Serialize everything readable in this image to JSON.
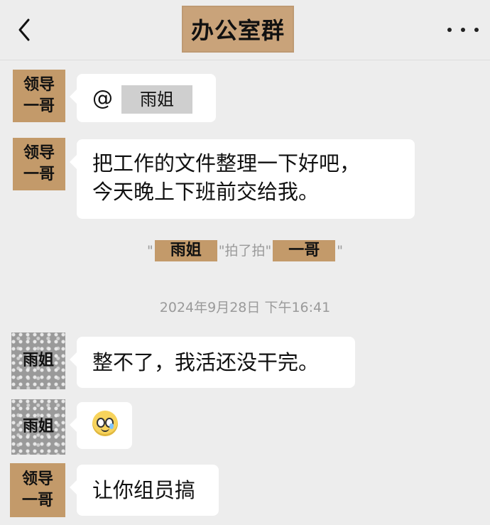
{
  "header": {
    "title": "办公室群",
    "back_icon": "chevron-left-icon",
    "more_icon": "more-dots-icon"
  },
  "avatars": {
    "leader": [
      "领导",
      "一哥"
    ],
    "sister": [
      "雨姐"
    ]
  },
  "messages": [
    {
      "sender": "领导一哥",
      "text_prefix": "@",
      "mention": "雨姐"
    },
    {
      "sender": "领导一哥",
      "lines": [
        "把工作的文件整理一下好吧，",
        "今天晚上下班前交给我。"
      ]
    },
    {
      "sender": "雨姐",
      "text": "整不了，我活还没干完。"
    },
    {
      "sender": "雨姐",
      "emoji": "woozy-face-emoji"
    },
    {
      "sender": "领导一哥",
      "text": "让你组员搞"
    }
  ],
  "system": {
    "pat_open": "\"",
    "pat_actor": "雨姐",
    "pat_middle": "\"拍了拍\"",
    "pat_target": "一哥",
    "pat_close": "\"",
    "timestamp": "2024年9月28日 下午16:41"
  }
}
